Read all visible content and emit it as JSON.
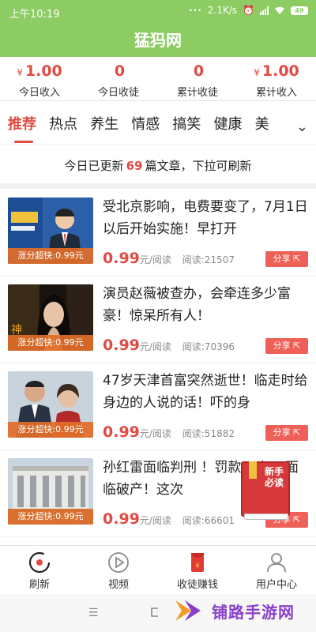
{
  "status_bar": {
    "time": "上午10:19",
    "network_speed": "2.1K/s",
    "battery": "49"
  },
  "app": {
    "title": "猛犸网"
  },
  "stats": [
    {
      "currency": "¥",
      "value": "1.00",
      "label": "今日收入"
    },
    {
      "currency": "",
      "value": "0",
      "label": "今日收徒"
    },
    {
      "currency": "",
      "value": "0",
      "label": "累计收徒"
    },
    {
      "currency": "¥",
      "value": "1.00",
      "label": "累计收入"
    }
  ],
  "tabs": [
    {
      "label": "推荐",
      "active": true
    },
    {
      "label": "热点"
    },
    {
      "label": "养生"
    },
    {
      "label": "情感"
    },
    {
      "label": "搞笑"
    },
    {
      "label": "健康"
    },
    {
      "label": "美"
    }
  ],
  "notice": {
    "prefix": "今日已更新",
    "count": "69",
    "suffix": "篇文章，下拉可刷新"
  },
  "articles": [
    {
      "title": "受北京影响，电费要变了，7月1日以后开始实施！早打开",
      "thumb_tag": "涨分超快:0.99元",
      "price": "0.99",
      "price_unit": "元/阅读",
      "reads": "阅读:21507",
      "share_label": "分享"
    },
    {
      "title": "演员赵薇被查办，会牵连多少富豪！惊呆所有人！",
      "thumb_tag": "涨分超快:0.99元",
      "price": "0.99",
      "price_unit": "元/阅读",
      "reads": "阅读:70396",
      "share_label": "分享"
    },
    {
      "title": "47岁天津首富突然逝世！临走时给身边的人说的话！吓的身",
      "thumb_tag": "涨分超快:0.99元",
      "price": "0.99",
      "price_unit": "元/阅读",
      "reads": "阅读:51882",
      "share_label": "分享"
    },
    {
      "title": "孙红雷面临判刑 ！罚款90亿，面临破产！这次",
      "thumb_tag": "涨分超快:0.99元",
      "price": "0.99",
      "price_unit": "元/阅读",
      "reads": "阅读:66601",
      "share_label": "分享"
    }
  ],
  "float_badge": {
    "label": "新手必读"
  },
  "bottom_nav": [
    {
      "label": "刷新",
      "icon": "refresh-icon"
    },
    {
      "label": "视频",
      "icon": "play-icon"
    },
    {
      "label": "收徒赚钱",
      "icon": "red-envelope-icon"
    },
    {
      "label": "用户中心",
      "icon": "user-icon"
    }
  ],
  "system_nav": {
    "menu": "☰"
  },
  "watermark": {
    "text": "铺路手游网"
  },
  "colors": {
    "brand_green": "#8ccc63",
    "accent_red": "#e04b43",
    "tag_orange": "#e16e28",
    "watermark_purple": "#8a40c9"
  }
}
